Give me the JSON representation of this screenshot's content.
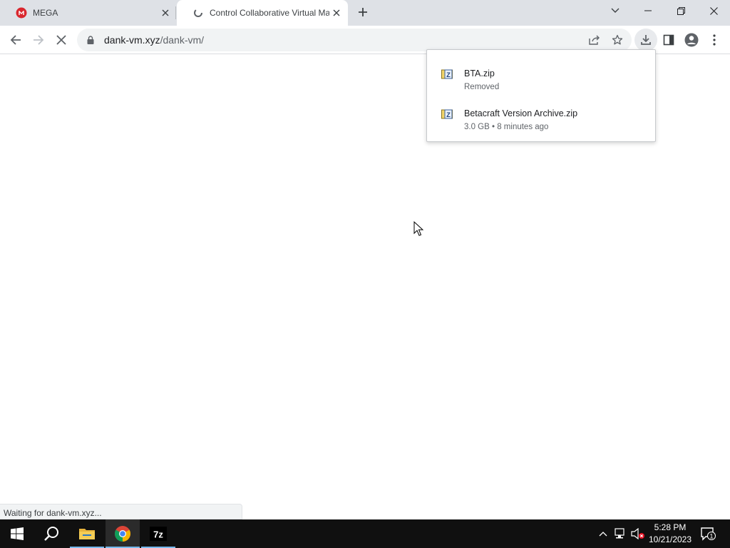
{
  "tabs": [
    {
      "title": "MEGA",
      "favicon": "mega-logo-icon",
      "active": false
    },
    {
      "title": "Control Collaborative Virtual Ma",
      "favicon": "loading-spinner-icon",
      "active": true
    }
  ],
  "toolbar": {
    "url_host": "dank-vm.xyz",
    "url_path": "/dank-vm/"
  },
  "downloads": [
    {
      "name": "BTA.zip",
      "status": "Removed",
      "icon": "zip-archive-icon"
    },
    {
      "name": "Betacraft Version Archive.zip",
      "status": "3.0 GB • 8 minutes ago",
      "icon": "zip-archive-icon"
    }
  ],
  "status_text": "Waiting for dank-vm.xyz...",
  "taskbar": {
    "apps": [
      "start-icon",
      "search-icon",
      "file-explorer-icon",
      "chrome-icon",
      "7zip-icon"
    ],
    "time": "5:28 PM",
    "date": "10/21/2023",
    "notification_count": "1"
  },
  "colors": {
    "tab_strip": "#dee1e6",
    "omnibox": "#f1f3f4",
    "taskbar": "#101010",
    "mega_red": "#d9272e",
    "accent_blue": "#76b9ed"
  }
}
